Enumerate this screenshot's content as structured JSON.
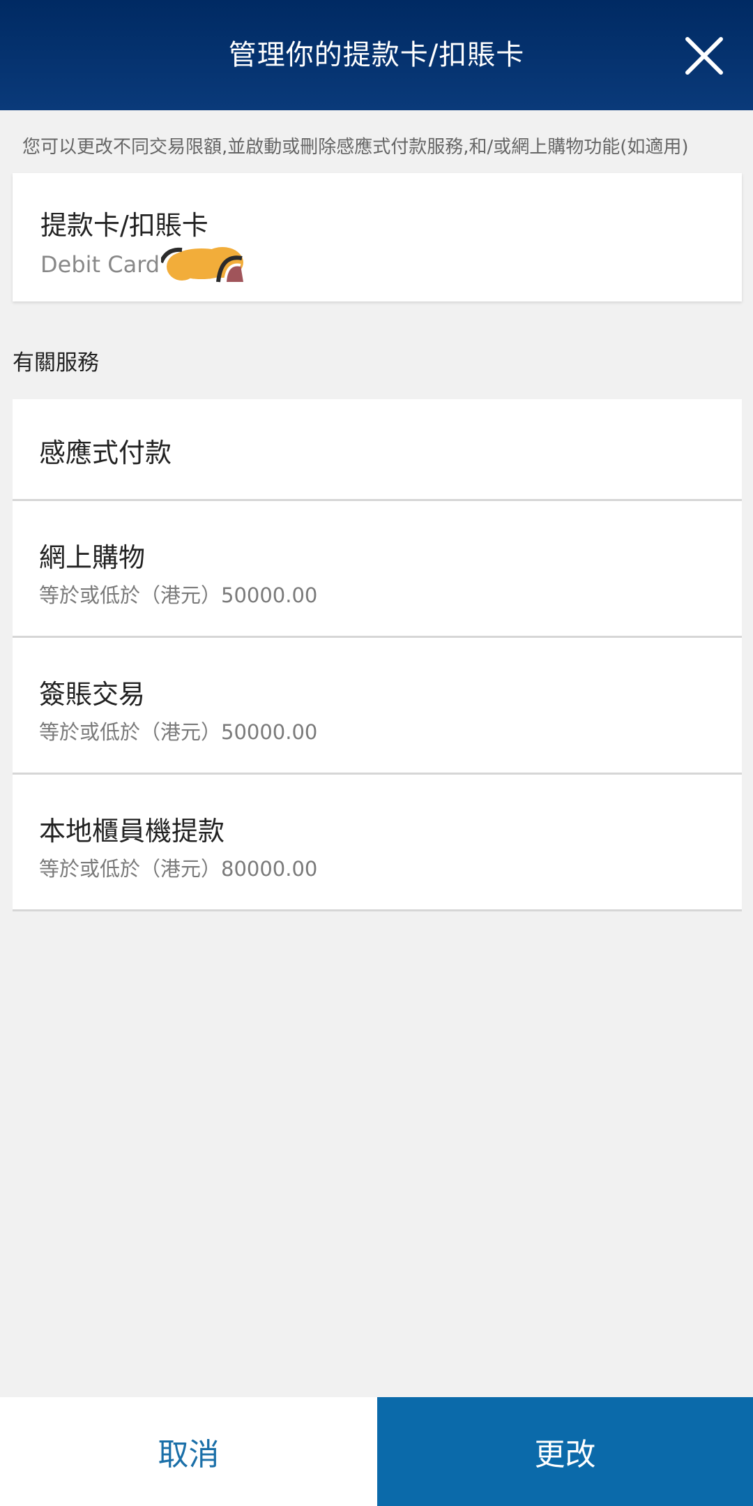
{
  "header": {
    "title": "管理你的提款卡/扣賬卡",
    "close_icon": "close-icon"
  },
  "intro": "您可以更改不同交易限額,並啟動或刪除感應式付款服務,和/或網上購物功能(如適用)",
  "card": {
    "title": "提款卡/扣賬卡",
    "subtitle": "Debit Card"
  },
  "section_label": "有關服務",
  "services": [
    {
      "title": "感應式付款",
      "subtitle": ""
    },
    {
      "title": "網上購物",
      "subtitle": "等於或低於（港元）50000.00"
    },
    {
      "title": "簽賬交易",
      "subtitle": "等於或低於（港元）50000.00"
    },
    {
      "title": "本地櫃員機提款",
      "subtitle": "等於或低於（港元）80000.00"
    }
  ],
  "footer": {
    "cancel_label": "取消",
    "change_label": "更改"
  },
  "colors": {
    "header_bg": "#002a63",
    "primary_button": "#0b6aaa",
    "cancel_text": "#1a6fa8",
    "page_bg": "#f1f1f1"
  }
}
